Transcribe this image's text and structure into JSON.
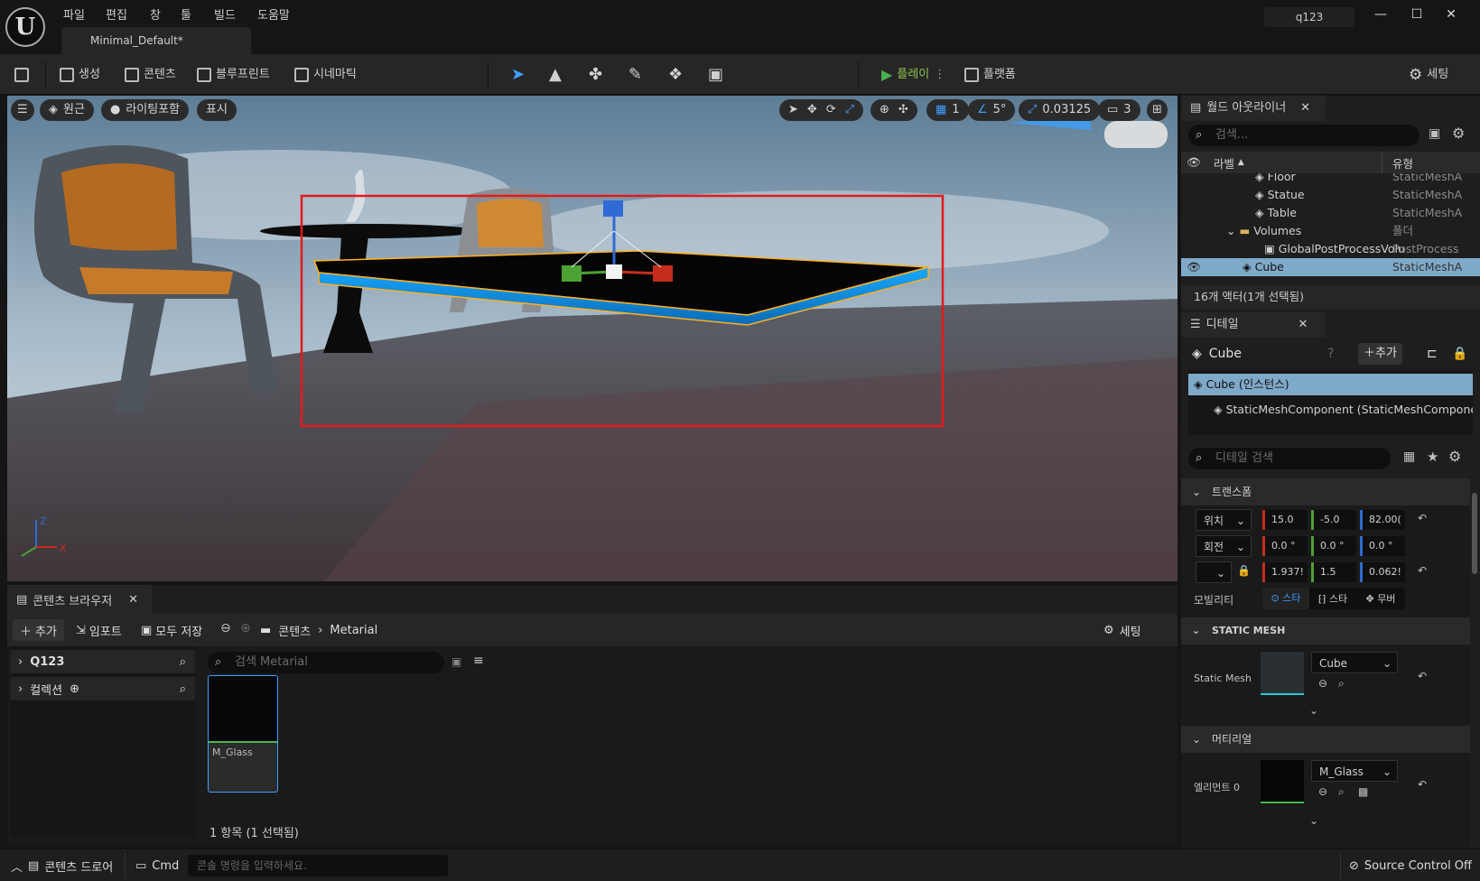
{
  "app": {
    "document_tab": "Minimal_Default*",
    "user": "q123"
  },
  "menu": [
    "파일",
    "편집",
    "창",
    "툴",
    "빌드",
    "도움말"
  ],
  "toolbar": {
    "create": "생성",
    "content": "콘텐츠",
    "blueprint": "블루프린트",
    "cinematic": "시네마틱",
    "play": "플레이",
    "platforms": "플랫폼",
    "settings": "세팅"
  },
  "viewport": {
    "perspective": "원근",
    "lighting": "라이팅포함",
    "show": "표시",
    "grid_size": "1",
    "rot_snap": "5°",
    "scale_snap": "0.03125",
    "camera_speed": "3"
  },
  "content_browser": {
    "title": "콘텐츠 브라우저",
    "add": "추가",
    "import": "임포트",
    "save_all": "모두 저장",
    "path_root": "콘텐츠",
    "path_folder": "Metarial",
    "settings": "세팅",
    "tree_root": "Q123",
    "collections": "컬렉션",
    "search_placeholder": "검색 Metarial",
    "asset_name": "M_Glass",
    "count_text": "1 항목 (1 선택됨)"
  },
  "statusbar": {
    "drawer": "콘텐츠 드로어",
    "cmd": "Cmd",
    "console_placeholder": "콘솔 명령을 입력하세요.",
    "source_control": "Source Control Off"
  },
  "outliner": {
    "title": "월드 아웃라이너",
    "search_placeholder": "검색...",
    "col_label": "라벨",
    "col_type": "유형",
    "rows": [
      {
        "label": "Floor",
        "type": "StaticMeshA"
      },
      {
        "label": "Statue",
        "type": "StaticMeshA"
      },
      {
        "label": "Table",
        "type": "StaticMeshA"
      },
      {
        "label": "Volumes",
        "type": "폴더"
      },
      {
        "label": "GlobalPostProcessVolu",
        "type": "PostProcess"
      },
      {
        "label": "Cube",
        "type": "StaticMeshA"
      }
    ],
    "footer": "16개 액터(1개 선택됨)"
  },
  "details": {
    "title": "디테일",
    "object": "Cube",
    "add": "추가",
    "instance": "Cube (인스턴스)",
    "component": "StaticMeshComponent (StaticMeshComponent",
    "search_placeholder": "디테일 검색",
    "transform": {
      "section": "트랜스폼",
      "location_label": "위치",
      "location": [
        "15.0",
        "-5.0",
        "82.00("
      ],
      "rotation_label": "회전",
      "rotation": [
        "0.0 °",
        "0.0 °",
        "0.0 °"
      ],
      "scale": [
        "1.937!",
        "1.5",
        "0.062!"
      ],
      "mobility_label": "모빌리티",
      "mobility": [
        "스타",
        "스타",
        "무버"
      ]
    },
    "static_mesh": {
      "section": "STATIC MESH",
      "label": "Static Mesh",
      "value": "Cube"
    },
    "materials": {
      "section": "머티리얼",
      "label": "엘리먼트 0",
      "value": "M_Glass"
    }
  }
}
